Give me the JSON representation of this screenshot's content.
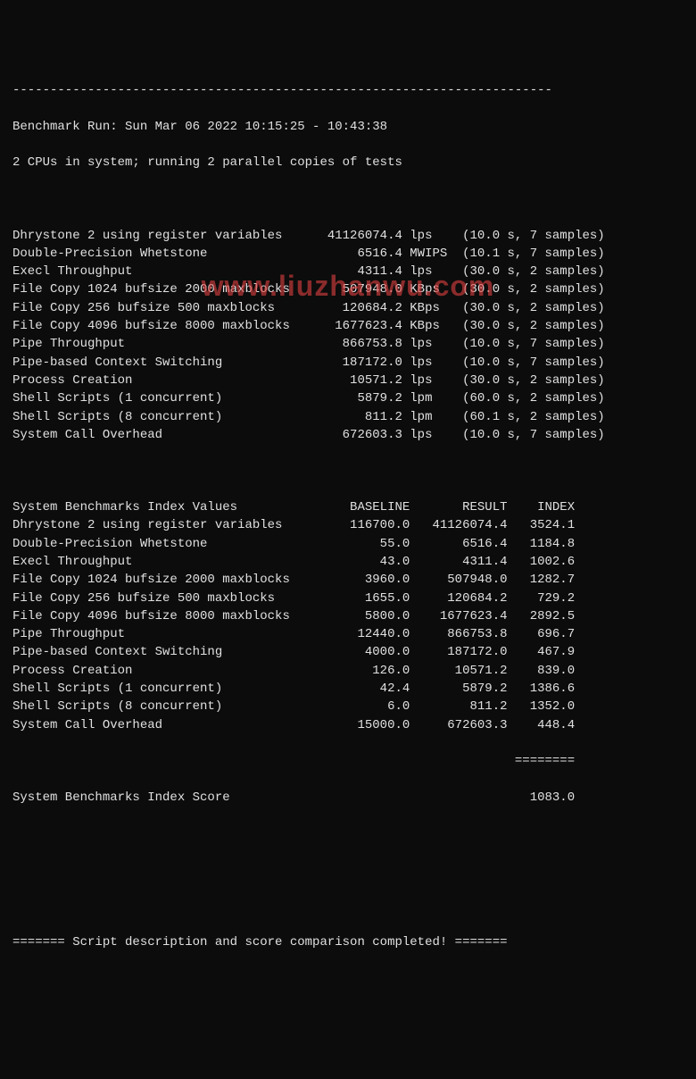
{
  "header": {
    "top_border": "------------------------------------------------------------------------",
    "run_line": "Benchmark Run: Sun Mar 06 2022 10:15:25 - 10:43:38",
    "cpu_line": "2 CPUs in system; running 2 parallel copies of tests"
  },
  "results": [
    {
      "name": "Dhrystone 2 using register variables",
      "value": "41126074.4",
      "unit": "lps",
      "timing": "(10.0 s, 7 samples)"
    },
    {
      "name": "Double-Precision Whetstone",
      "value": "6516.4",
      "unit": "MWIPS",
      "timing": "(10.1 s, 7 samples)"
    },
    {
      "name": "Execl Throughput",
      "value": "4311.4",
      "unit": "lps",
      "timing": "(30.0 s, 2 samples)"
    },
    {
      "name": "File Copy 1024 bufsize 2000 maxblocks",
      "value": "507948.0",
      "unit": "KBps",
      "timing": "(30.0 s, 2 samples)"
    },
    {
      "name": "File Copy 256 bufsize 500 maxblocks",
      "value": "120684.2",
      "unit": "KBps",
      "timing": "(30.0 s, 2 samples)"
    },
    {
      "name": "File Copy 4096 bufsize 8000 maxblocks",
      "value": "1677623.4",
      "unit": "KBps",
      "timing": "(30.0 s, 2 samples)"
    },
    {
      "name": "Pipe Throughput",
      "value": "866753.8",
      "unit": "lps",
      "timing": "(10.0 s, 7 samples)"
    },
    {
      "name": "Pipe-based Context Switching",
      "value": "187172.0",
      "unit": "lps",
      "timing": "(10.0 s, 7 samples)"
    },
    {
      "name": "Process Creation",
      "value": "10571.2",
      "unit": "lps",
      "timing": "(30.0 s, 2 samples)"
    },
    {
      "name": "Shell Scripts (1 concurrent)",
      "value": "5879.2",
      "unit": "lpm",
      "timing": "(60.0 s, 2 samples)"
    },
    {
      "name": "Shell Scripts (8 concurrent)",
      "value": "811.2",
      "unit": "lpm",
      "timing": "(60.1 s, 2 samples)"
    },
    {
      "name": "System Call Overhead",
      "value": "672603.3",
      "unit": "lps",
      "timing": "(10.0 s, 7 samples)"
    }
  ],
  "index_header": {
    "label": "System Benchmarks Index Values",
    "col_baseline": "BASELINE",
    "col_result": "RESULT",
    "col_index": "INDEX"
  },
  "index_rows": [
    {
      "name": "Dhrystone 2 using register variables",
      "baseline": "116700.0",
      "result": "41126074.4",
      "index": "3524.1"
    },
    {
      "name": "Double-Precision Whetstone",
      "baseline": "55.0",
      "result": "6516.4",
      "index": "1184.8"
    },
    {
      "name": "Execl Throughput",
      "baseline": "43.0",
      "result": "4311.4",
      "index": "1002.6"
    },
    {
      "name": "File Copy 1024 bufsize 2000 maxblocks",
      "baseline": "3960.0",
      "result": "507948.0",
      "index": "1282.7"
    },
    {
      "name": "File Copy 256 bufsize 500 maxblocks",
      "baseline": "1655.0",
      "result": "120684.2",
      "index": "729.2"
    },
    {
      "name": "File Copy 4096 bufsize 8000 maxblocks",
      "baseline": "5800.0",
      "result": "1677623.4",
      "index": "2892.5"
    },
    {
      "name": "Pipe Throughput",
      "baseline": "12440.0",
      "result": "866753.8",
      "index": "696.7"
    },
    {
      "name": "Pipe-based Context Switching",
      "baseline": "4000.0",
      "result": "187172.0",
      "index": "467.9"
    },
    {
      "name": "Process Creation",
      "baseline": "126.0",
      "result": "10571.2",
      "index": "839.0"
    },
    {
      "name": "Shell Scripts (1 concurrent)",
      "baseline": "42.4",
      "result": "5879.2",
      "index": "1386.6"
    },
    {
      "name": "Shell Scripts (8 concurrent)",
      "baseline": "6.0",
      "result": "811.2",
      "index": "1352.0"
    },
    {
      "name": "System Call Overhead",
      "baseline": "15000.0",
      "result": "672603.3",
      "index": "448.4"
    }
  ],
  "score_sep": "                                                                   ========",
  "score_line": {
    "label": "System Benchmarks Index Score",
    "value": "1083.0"
  },
  "footer": {
    "blank": "",
    "line": "======= Script description and score comparison completed! ======="
  },
  "watermark": "www.liuzhanwu.com"
}
